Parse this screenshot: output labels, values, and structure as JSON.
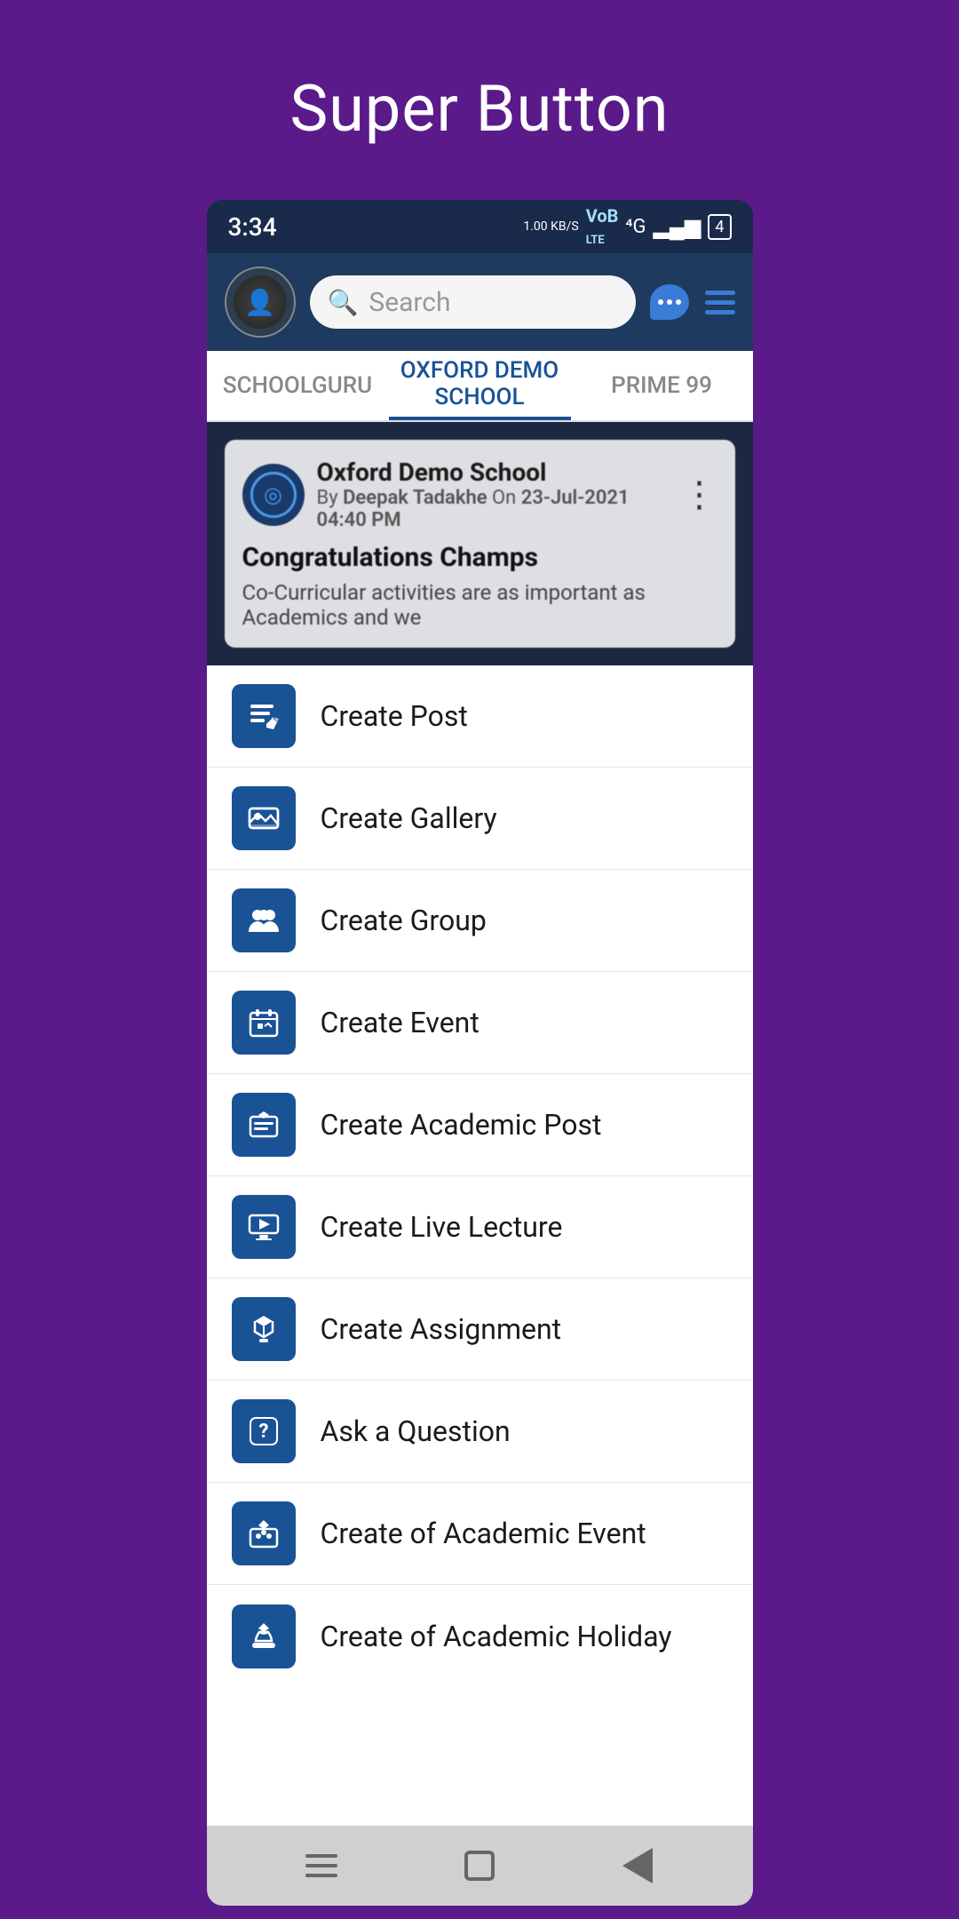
{
  "page": {
    "title": "Super Button",
    "background_color": "#5a1a8a"
  },
  "status_bar": {
    "time": "3:34",
    "data_speed": "1.00 KB/S",
    "network": "4G",
    "signal_bars": "▮▮▮",
    "battery_level": "4"
  },
  "header": {
    "search_placeholder": "Search",
    "chat_icon": "chat-bubble-icon",
    "menu_icon": "hamburger-icon"
  },
  "tabs": [
    {
      "label": "SCHOOLGURU",
      "active": false
    },
    {
      "label": "OXFORD DEMO SCHOOL",
      "active": true
    },
    {
      "label": "PRIME 99",
      "active": false
    }
  ],
  "post": {
    "school_name": "Oxford Demo School",
    "author": "Deepak Tadakhe",
    "date": "23-Jul-2021 04:40 PM",
    "by_label": "By",
    "on_label": "On",
    "title": "Congratulations Champs",
    "body": "Co-Curricular activities are as important as Academics and we"
  },
  "menu_items": [
    {
      "id": "create-post",
      "label": "Create Post",
      "icon": "📝"
    },
    {
      "id": "create-gallery",
      "label": "Create Gallery",
      "icon": "🖼"
    },
    {
      "id": "create-group",
      "label": "Create Group",
      "icon": "👥"
    },
    {
      "id": "create-event",
      "label": "Create Event",
      "icon": "📅"
    },
    {
      "id": "create-academic-post",
      "label": "Create Academic Post",
      "icon": "🎓"
    },
    {
      "id": "create-live-lecture",
      "label": "Create Live Lecture",
      "icon": "🖥"
    },
    {
      "id": "create-assignment",
      "label": "Create Assignment",
      "icon": "🏫"
    },
    {
      "id": "ask-question",
      "label": "Ask a Question",
      "icon": "❓"
    },
    {
      "id": "create-academic-event",
      "label": "Create of Academic Event",
      "icon": "🎓"
    },
    {
      "id": "create-academic-holiday",
      "label": "Create of Academic Holiday",
      "icon": "🌴"
    }
  ],
  "bottom_nav": {
    "menu_icon": "hamburger",
    "home_icon": "square",
    "back_icon": "triangle"
  }
}
